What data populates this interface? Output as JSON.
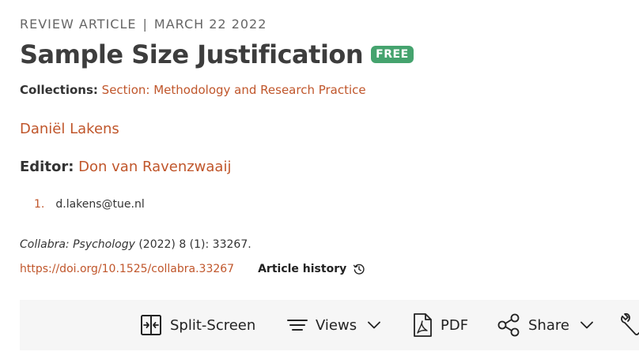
{
  "article_type": "REVIEW ARTICLE",
  "separator": "|",
  "date": "MARCH 22 2022",
  "title": "Sample Size Justification",
  "badge": "FREE",
  "collections": {
    "label": "Collections:",
    "value": "Section: Methodology and Research Practice"
  },
  "author": "Daniël Lakens",
  "editor": {
    "label": "Editor:",
    "name": "Don van Ravenzwaaij"
  },
  "affiliations": [
    {
      "num": "1.",
      "text": "d.lakens@tue.nl"
    }
  ],
  "citation": {
    "journal": "Collabra: Psychology",
    "details": " (2022) 8 (1): 33267."
  },
  "doi": "https://doi.org/10.1525/collabra.33267",
  "article_history": "Article history",
  "toolbar": {
    "split_screen": "Split-Screen",
    "views": "Views",
    "pdf": "PDF",
    "share": "Share"
  },
  "colors": {
    "link": "#c0562b",
    "badge": "#45a36e",
    "toolbar_bg": "#f6f6f6"
  },
  "icons": [
    "split-screen-icon",
    "views-icon",
    "pdf-icon",
    "share-icon",
    "chevron-down-icon",
    "history-icon",
    "tools-icon"
  ]
}
